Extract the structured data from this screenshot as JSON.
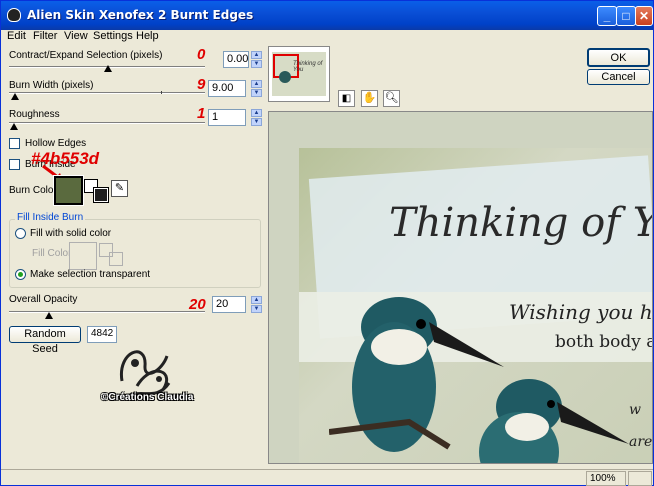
{
  "window": {
    "title": "Alien Skin Xenofex 2 Burnt Edges"
  },
  "menu": [
    "Edit",
    "Filter",
    "View",
    "Settings",
    "Help"
  ],
  "controls": {
    "contract": {
      "label": "Contract/Expand Selection (pixels)",
      "value": "0.00",
      "annotation": "0"
    },
    "burn_width": {
      "label": "Burn Width (pixels)",
      "value": "9.00",
      "annotation": "9"
    },
    "roughness": {
      "label": "Roughness",
      "value": "1",
      "annotation": "1"
    },
    "hollow_edges": {
      "label": "Hollow Edges"
    },
    "burn_inside": {
      "label": "Burn Inside"
    },
    "burn_color": {
      "label": "Burn Color",
      "annotation": "#4b553d",
      "swatch": "#5a6a3e"
    },
    "fill_inside_burn": {
      "group_label": "Fill Inside Burn",
      "fill_solid": "Fill with solid color",
      "fill_color": "Fill Color",
      "make_transparent": "Make selection transparent"
    },
    "overall_opacity": {
      "label": "Overall Opacity",
      "value": "20",
      "annotation": "20"
    },
    "random_seed": {
      "label": "Random Seed",
      "value": "4842"
    }
  },
  "watermark": {
    "text": "©Créations Claudia"
  },
  "buttons": {
    "ok": "OK",
    "cancel": "Cancel"
  },
  "preview": {
    "thumb_text": "Thinking of You",
    "headline": "Thinking of Yo",
    "line1": "Wishing you hea",
    "line2": "both body a",
    "line3": "w",
    "line4": "are"
  },
  "status": {
    "zoom": "100%"
  }
}
